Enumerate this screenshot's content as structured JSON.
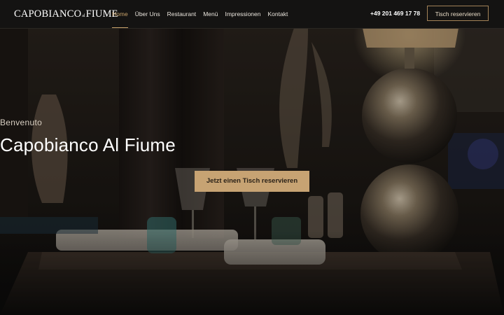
{
  "header": {
    "logo": {
      "main": "Capobianco",
      "small": "al",
      "tail": "Fiume"
    },
    "nav": [
      {
        "label": "Home",
        "active": true
      },
      {
        "label": "Über Uns"
      },
      {
        "label": "Restaurant"
      },
      {
        "label": "Menü"
      },
      {
        "label": "Impressionen"
      },
      {
        "label": "Kontakt"
      }
    ],
    "phone": "+49 201 469 17 78",
    "reserve_button": "Tisch reservieren"
  },
  "hero": {
    "eyebrow": "Benvenuto",
    "title": "Capobianco Al Fiume",
    "cta": "Jetzt einen Tisch reservieren"
  },
  "colors": {
    "accent": "#c7a373",
    "header_bg": "#141312",
    "page_bg": "#0d0c0b"
  }
}
